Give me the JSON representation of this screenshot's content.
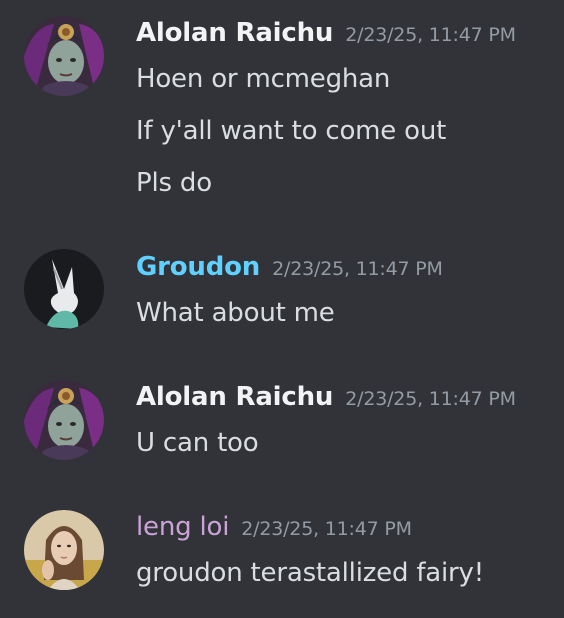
{
  "messages": [
    {
      "author": "Alolan Raichu",
      "author_color": "#f2f3f5",
      "timestamp": "2/23/25, 11:47 PM",
      "avatar_icon": "alolan-raichu-avatar",
      "lines": [
        "Hoen or mcmeghan",
        "If y'all want to come out",
        "Pls do"
      ]
    },
    {
      "author": "Groudon",
      "author_color": "#5fd0ff",
      "timestamp": "2/23/25, 11:47 PM",
      "avatar_icon": "groudon-avatar",
      "lines": [
        "What about me"
      ]
    },
    {
      "author": "Alolan Raichu",
      "author_color": "#f2f3f5",
      "timestamp": "2/23/25, 11:47 PM",
      "avatar_icon": "alolan-raichu-avatar",
      "lines": [
        "U can too"
      ]
    },
    {
      "author": "leng loi",
      "author_color": "#c9a2d6",
      "timestamp": "2/23/25, 11:47 PM",
      "avatar_icon": "leng-loi-avatar",
      "lines": [
        "groudon terastallized fairy!"
      ]
    }
  ]
}
